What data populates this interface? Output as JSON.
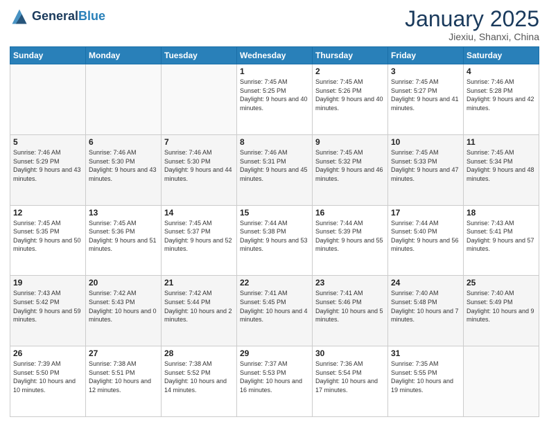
{
  "header": {
    "logo_line1": "General",
    "logo_line2": "Blue",
    "month_title": "January 2025",
    "location": "Jiexiu, Shanxi, China"
  },
  "days_of_week": [
    "Sunday",
    "Monday",
    "Tuesday",
    "Wednesday",
    "Thursday",
    "Friday",
    "Saturday"
  ],
  "weeks": [
    [
      {
        "day": "",
        "info": ""
      },
      {
        "day": "",
        "info": ""
      },
      {
        "day": "",
        "info": ""
      },
      {
        "day": "1",
        "info": "Sunrise: 7:45 AM\nSunset: 5:25 PM\nDaylight: 9 hours\nand 40 minutes."
      },
      {
        "day": "2",
        "info": "Sunrise: 7:45 AM\nSunset: 5:26 PM\nDaylight: 9 hours\nand 40 minutes."
      },
      {
        "day": "3",
        "info": "Sunrise: 7:45 AM\nSunset: 5:27 PM\nDaylight: 9 hours\nand 41 minutes."
      },
      {
        "day": "4",
        "info": "Sunrise: 7:46 AM\nSunset: 5:28 PM\nDaylight: 9 hours\nand 42 minutes."
      }
    ],
    [
      {
        "day": "5",
        "info": "Sunrise: 7:46 AM\nSunset: 5:29 PM\nDaylight: 9 hours\nand 43 minutes."
      },
      {
        "day": "6",
        "info": "Sunrise: 7:46 AM\nSunset: 5:30 PM\nDaylight: 9 hours\nand 43 minutes."
      },
      {
        "day": "7",
        "info": "Sunrise: 7:46 AM\nSunset: 5:30 PM\nDaylight: 9 hours\nand 44 minutes."
      },
      {
        "day": "8",
        "info": "Sunrise: 7:46 AM\nSunset: 5:31 PM\nDaylight: 9 hours\nand 45 minutes."
      },
      {
        "day": "9",
        "info": "Sunrise: 7:45 AM\nSunset: 5:32 PM\nDaylight: 9 hours\nand 46 minutes."
      },
      {
        "day": "10",
        "info": "Sunrise: 7:45 AM\nSunset: 5:33 PM\nDaylight: 9 hours\nand 47 minutes."
      },
      {
        "day": "11",
        "info": "Sunrise: 7:45 AM\nSunset: 5:34 PM\nDaylight: 9 hours\nand 48 minutes."
      }
    ],
    [
      {
        "day": "12",
        "info": "Sunrise: 7:45 AM\nSunset: 5:35 PM\nDaylight: 9 hours\nand 50 minutes."
      },
      {
        "day": "13",
        "info": "Sunrise: 7:45 AM\nSunset: 5:36 PM\nDaylight: 9 hours\nand 51 minutes."
      },
      {
        "day": "14",
        "info": "Sunrise: 7:45 AM\nSunset: 5:37 PM\nDaylight: 9 hours\nand 52 minutes."
      },
      {
        "day": "15",
        "info": "Sunrise: 7:44 AM\nSunset: 5:38 PM\nDaylight: 9 hours\nand 53 minutes."
      },
      {
        "day": "16",
        "info": "Sunrise: 7:44 AM\nSunset: 5:39 PM\nDaylight: 9 hours\nand 55 minutes."
      },
      {
        "day": "17",
        "info": "Sunrise: 7:44 AM\nSunset: 5:40 PM\nDaylight: 9 hours\nand 56 minutes."
      },
      {
        "day": "18",
        "info": "Sunrise: 7:43 AM\nSunset: 5:41 PM\nDaylight: 9 hours\nand 57 minutes."
      }
    ],
    [
      {
        "day": "19",
        "info": "Sunrise: 7:43 AM\nSunset: 5:42 PM\nDaylight: 9 hours\nand 59 minutes."
      },
      {
        "day": "20",
        "info": "Sunrise: 7:42 AM\nSunset: 5:43 PM\nDaylight: 10 hours\nand 0 minutes."
      },
      {
        "day": "21",
        "info": "Sunrise: 7:42 AM\nSunset: 5:44 PM\nDaylight: 10 hours\nand 2 minutes."
      },
      {
        "day": "22",
        "info": "Sunrise: 7:41 AM\nSunset: 5:45 PM\nDaylight: 10 hours\nand 4 minutes."
      },
      {
        "day": "23",
        "info": "Sunrise: 7:41 AM\nSunset: 5:46 PM\nDaylight: 10 hours\nand 5 minutes."
      },
      {
        "day": "24",
        "info": "Sunrise: 7:40 AM\nSunset: 5:48 PM\nDaylight: 10 hours\nand 7 minutes."
      },
      {
        "day": "25",
        "info": "Sunrise: 7:40 AM\nSunset: 5:49 PM\nDaylight: 10 hours\nand 9 minutes."
      }
    ],
    [
      {
        "day": "26",
        "info": "Sunrise: 7:39 AM\nSunset: 5:50 PM\nDaylight: 10 hours\nand 10 minutes."
      },
      {
        "day": "27",
        "info": "Sunrise: 7:38 AM\nSunset: 5:51 PM\nDaylight: 10 hours\nand 12 minutes."
      },
      {
        "day": "28",
        "info": "Sunrise: 7:38 AM\nSunset: 5:52 PM\nDaylight: 10 hours\nand 14 minutes."
      },
      {
        "day": "29",
        "info": "Sunrise: 7:37 AM\nSunset: 5:53 PM\nDaylight: 10 hours\nand 16 minutes."
      },
      {
        "day": "30",
        "info": "Sunrise: 7:36 AM\nSunset: 5:54 PM\nDaylight: 10 hours\nand 17 minutes."
      },
      {
        "day": "31",
        "info": "Sunrise: 7:35 AM\nSunset: 5:55 PM\nDaylight: 10 hours\nand 19 minutes."
      },
      {
        "day": "",
        "info": ""
      }
    ]
  ]
}
